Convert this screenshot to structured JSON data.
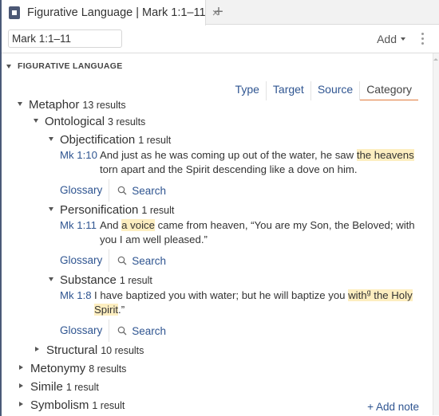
{
  "tab": {
    "title": "Figurative Language | Mark 1:1–11",
    "icon": "panel-icon",
    "close_icon": "×",
    "new_tab_icon": "+"
  },
  "toolbar": {
    "reference_value": "Mark 1:1–11",
    "add_label": "Add",
    "more_icon": "kebab-menu-icon"
  },
  "section": {
    "title": "FIGURATIVE LANGUAGE"
  },
  "view_tabs": [
    {
      "label": "Type",
      "active": false
    },
    {
      "label": "Target",
      "active": false
    },
    {
      "label": "Source",
      "active": false
    },
    {
      "label": "Category",
      "active": true
    }
  ],
  "tree": {
    "metaphor": {
      "label": "Metaphor",
      "count": "13 results",
      "expanded": true
    },
    "ontological": {
      "label": "Ontological",
      "count": "3 results",
      "expanded": true
    },
    "objectification": {
      "label": "Objectification",
      "count": "1 result",
      "expanded": true,
      "ref": "Mk 1:10",
      "text_before": "And just as he was coming up out of the water, he saw ",
      "highlight": "the heavens",
      "text_after": " torn apart and the Spirit descending like a dove on him."
    },
    "personification": {
      "label": "Personification",
      "count": "1 result",
      "expanded": true,
      "ref": "Mk 1:11",
      "text_before": "And ",
      "highlight": "a voice",
      "text_after": " came from heaven, “You are my Son, the Beloved; with you I am well pleased.”"
    },
    "substance": {
      "label": "Substance",
      "count": "1 result",
      "expanded": true,
      "ref": "Mk 1:8",
      "text_before": "I have baptized you with water; but he will baptize you ",
      "highlight_a": "with",
      "footnote": "g",
      "highlight_b": " the Holy Spirit",
      "text_after": ".”"
    },
    "structural": {
      "label": "Structural",
      "count": "10 results",
      "expanded": false
    },
    "metonymy": {
      "label": "Metonymy",
      "count": "8 results",
      "expanded": false
    },
    "simile": {
      "label": "Simile",
      "count": "1 result",
      "expanded": false
    },
    "symbolism": {
      "label": "Symbolism",
      "count": "1 result",
      "expanded": false
    }
  },
  "links": {
    "glossary": "Glossary",
    "search": "Search"
  },
  "add_note": "+ Add note",
  "colors": {
    "link": "#2f5591",
    "highlight": "#fdeec0",
    "active_tab_underline": "#e07a3c"
  }
}
